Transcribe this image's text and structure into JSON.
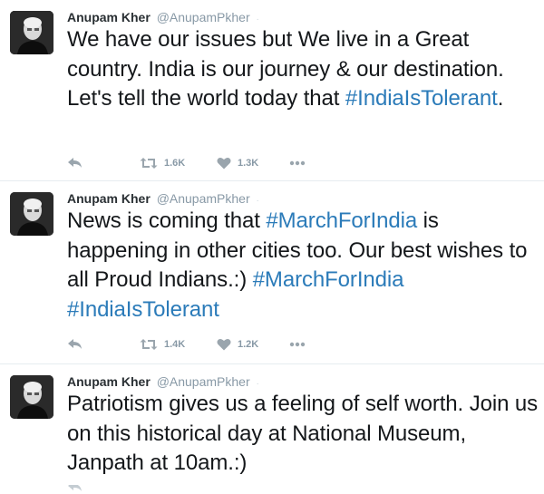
{
  "tweets": [
    {
      "fullname": "Anupam Kher",
      "username": "@AnupamPkher",
      "separator": "·",
      "text_parts": [
        "We have our issues but We live in a Great country. India is our journey & our destination. Let's tell the world today that ",
        "#IndiaIsTolerant",
        "."
      ],
      "retweets": "1.6K",
      "likes": "1.3K"
    },
    {
      "fullname": "Anupam Kher",
      "username": "@AnupamPkher",
      "separator": "·",
      "text_parts": [
        "News is coming that ",
        "#MarchForIndia",
        " is happening in other cities too. Our best wishes to all Proud Indians.:) ",
        "#MarchForIndia",
        " ",
        "#IndiaIsTolerant"
      ],
      "retweets": "1.4K",
      "likes": "1.2K"
    },
    {
      "fullname": "Anupam Kher",
      "username": "@AnupamPkher",
      "separator": "·",
      "text_parts": [
        "Patriotism gives us a feeling of self worth. Join us on this historical day at National Museum, Janpath at 10am.:)"
      ]
    }
  ],
  "colors": {
    "hashtag": "#2b7bb9",
    "name": "#292f33",
    "handle": "#8899a6",
    "action_icon": "#9aa5ad",
    "divider": "#e6ecf0"
  },
  "icons": [
    "reply-icon",
    "retweet-icon",
    "heart-icon",
    "more-icon"
  ]
}
